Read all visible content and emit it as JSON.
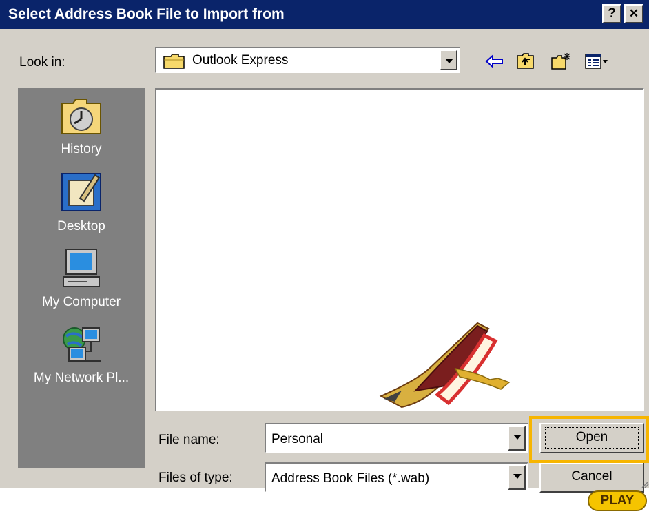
{
  "dialog": {
    "title": "Select Address Book File to Import from",
    "help_label": "?",
    "close_label": "✕"
  },
  "lookin": {
    "label": "Look in:",
    "value": "Outlook Express"
  },
  "toolbar": {
    "icons": [
      "back-arrow-icon",
      "up-one-level-icon",
      "create-new-folder-icon",
      "view-menu-icon"
    ]
  },
  "places": [
    {
      "label": "History",
      "icon": "history-icon"
    },
    {
      "label": "Desktop",
      "icon": "desktop-icon"
    },
    {
      "label": "My Computer",
      "icon": "my-computer-icon"
    },
    {
      "label": "My Network Pl...",
      "icon": "my-network-places-icon"
    }
  ],
  "filename": {
    "label": "File name:",
    "value": "Personal"
  },
  "filetype": {
    "label": "Files of type:",
    "value": "Address Book Files (*.wab)"
  },
  "buttons": {
    "open": "Open",
    "cancel": "Cancel"
  },
  "play_label": "PLAY",
  "colors": {
    "titlebar": "#0a246a",
    "dialog": "#d4d0c8",
    "highlight": "#f7b500"
  }
}
